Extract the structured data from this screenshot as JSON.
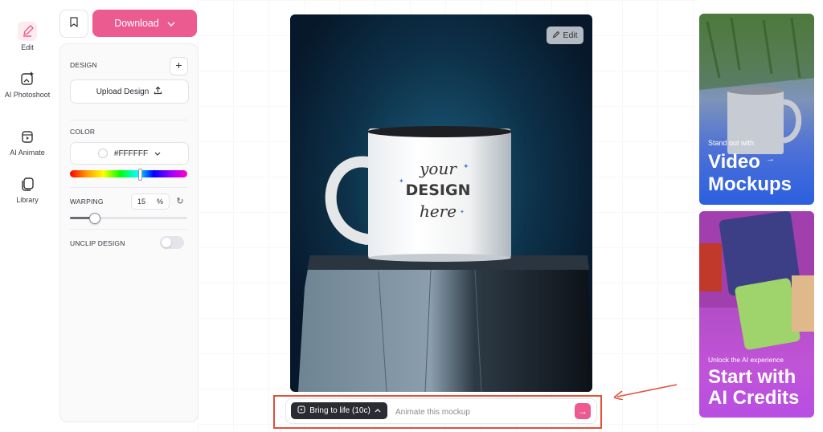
{
  "rail": {
    "items": [
      {
        "label": "Edit",
        "icon": "pencil-icon",
        "active": true
      },
      {
        "label": "AI Photoshoot",
        "icon": "image-sparkle-icon"
      },
      {
        "label": "AI Animate",
        "icon": "video-sparkle-icon"
      },
      {
        "label": "Library",
        "icon": "library-icon"
      }
    ]
  },
  "toolbar": {
    "download_label": "Download"
  },
  "panel": {
    "design_label": "DESIGN",
    "upload_label": "Upload Design",
    "color_label": "COLOR",
    "color_value": "#FFFFFF",
    "hue_position": 0.58,
    "warping_label": "WARPING",
    "warping_value": "15",
    "warping_unit": "%",
    "warping_slider": 0.15,
    "unclip_label": "UNCLIP DESIGN",
    "unclip_on": false
  },
  "canvas": {
    "edit_label": "Edit",
    "mug_text": {
      "line1": "your",
      "line2": "DESIGN",
      "line3": "here"
    }
  },
  "prompt": {
    "bring_label": "Bring to life (10c)",
    "placeholder": "Animate this mockup",
    "send_icon": "arrow-right-icon"
  },
  "ads": {
    "ad1": {
      "small": "Stand out with",
      "big1": "Video",
      "big2": "Mockups"
    },
    "ad2": {
      "small": "Unlock the AI experience",
      "big1": "Start with",
      "big2": "AI Credits"
    }
  },
  "colors": {
    "accent": "#EC5B8F",
    "highlight": "#E0513A"
  }
}
